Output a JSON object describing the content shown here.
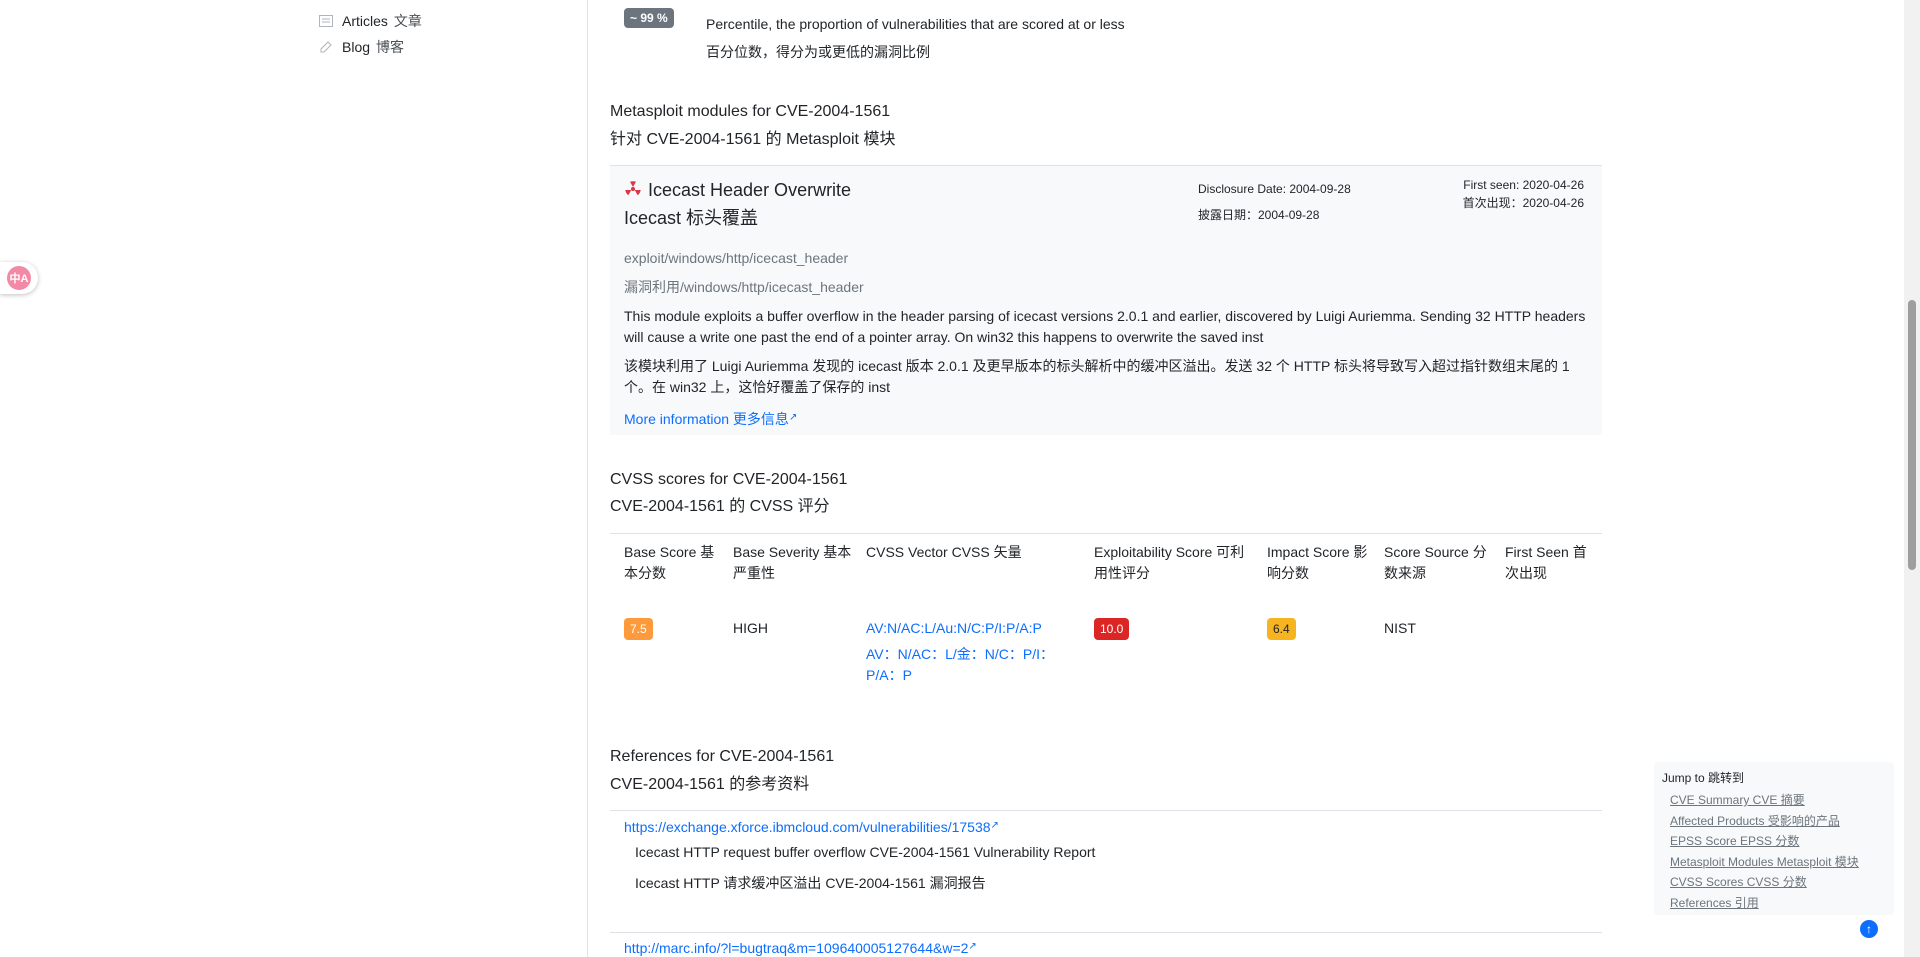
{
  "sidebar": {
    "items": [
      {
        "label": "Articles",
        "zh": "文章",
        "icon": "articles-icon"
      },
      {
        "label": "Blog",
        "zh": "博客",
        "icon": "blog-icon"
      }
    ]
  },
  "translate_widget": {
    "label": "中A"
  },
  "epss": {
    "badge": "~ 99 %",
    "line_en": "Percentile, the proportion of vulnerabilities that are scored at or less",
    "line_zh": "百分位数，得分为或更低的漏洞比例"
  },
  "metasploit": {
    "title_en": "Metasploit modules for CVE-2004-1561",
    "title_zh": "针对 CVE-2004-1561 的 Metasploit 模块",
    "module": {
      "icon": "radiation-icon",
      "name_en": "Icecast Header Overwrite",
      "name_zh": "Icecast 标头覆盖",
      "disclosure_en": "Disclosure Date: 2004-09-28",
      "disclosure_zh": "披露日期：2004-09-28",
      "first_seen_en": "First seen: 2020-04-26",
      "first_seen_zh": "首次出现：2020-04-26",
      "path_en": "exploit/windows/http/icecast_header",
      "path_zh": "漏洞利用/windows/http/icecast_header",
      "desc_en": "This module exploits a buffer overflow in the header parsing of icecast versions 2.0.1 and earlier, discovered by Luigi Auriemma. Sending 32 HTTP headers will cause a write one past the end of a pointer array. On win32 this happens to overwrite the saved inst",
      "desc_zh": "该模块利用了 Luigi Auriemma 发现的 icecast 版本 2.0.1 及更早版本的标头解析中的缓冲区溢出。发送 32 个 HTTP 标头将导致写入超过指针数组末尾的 1 个。在 win32 上，这恰好覆盖了保存的 inst",
      "more_info": "More information 更多信息"
    }
  },
  "cvss": {
    "title_en": "CVSS scores for CVE-2004-1561",
    "title_zh": "CVE-2004-1561 的 CVSS 评分",
    "headers": [
      "Base Score 基本分数",
      "Base Severity 基本严重性",
      "CVSS Vector CVSS 矢量",
      "Exploitability Score 可利用性评分",
      "Impact Score 影响分数",
      "Score Source 分数来源",
      "First Seen 首次出现"
    ],
    "row": {
      "base_score": "7.5",
      "severity": "HIGH",
      "vector_en": "AV:N/AC:L/Au:N/C:P/I:P/A:P",
      "vector_zh": "AV：N/AC：L/金：N/C：P/I：P/A：P",
      "exploitability": "10.0",
      "impact": "6.4",
      "source": "NIST",
      "first_seen": ""
    },
    "colors": {
      "base": "#fd9b3c",
      "exploit": "#dc2626",
      "impact": "#f6b420"
    }
  },
  "references": {
    "title_en": "References for CVE-2004-1561",
    "title_zh": "CVE-2004-1561 的参考资料",
    "items": [
      {
        "url": "https://exchange.xforce.ibmcloud.com/vulnerabilities/17538",
        "text_en": "Icecast HTTP request buffer overflow CVE-2004-1561 Vulnerability Report",
        "text_zh": "Icecast HTTP 请求缓冲区溢出 CVE-2004-1561 漏洞报告"
      },
      {
        "url": "http://marc.info/?l=bugtraq&m=109640005127644&w=2"
      }
    ]
  },
  "jump_to": {
    "title": "Jump to  跳转到",
    "links": [
      "CVE Summary  CVE 摘要",
      "Affected Products  受影响的产品",
      "EPSS Score  EPSS 分数",
      "Metasploit Modules  Metasploit 模块",
      "CVSS Scores  CVSS 分数",
      "References  引用"
    ]
  }
}
